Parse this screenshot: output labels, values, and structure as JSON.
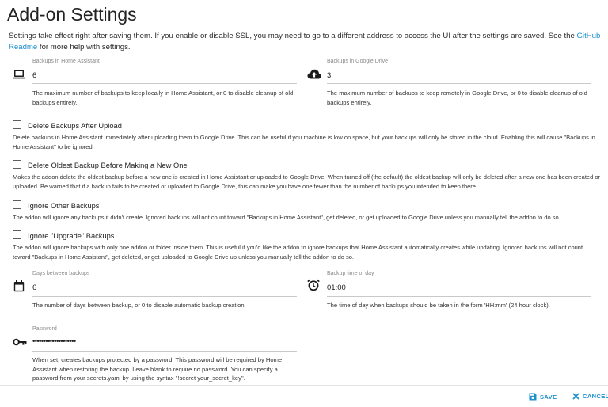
{
  "page": {
    "title": "Add-on Settings"
  },
  "intro": {
    "text_before": "Settings take effect right after saving them. If you enable or disable SSL, you may need to go to a different address to access the UI after the settings are saved. See the ",
    "link_text": "GitHub Readme",
    "text_after": " for more help with settings."
  },
  "fields": {
    "backups_ha": {
      "label": "Backups in Home Assistant",
      "value": "6",
      "help": "The maximum number of backups to keep locally in Home Assistant, or 0 to disable cleanup of old backups entirely.",
      "icon": "laptop-icon"
    },
    "backups_gd": {
      "label": "Backups in Google Drive",
      "value": "3",
      "help": "The maximum number of backups to keep remotely in Google Drive, or 0 to disable cleanup of old backups entirely.",
      "icon": "cloud-upload-icon"
    },
    "days_between": {
      "label": "Days between backups",
      "value": "6",
      "help": "The number of days between backup, or 0 to disable automatic backup creation.",
      "icon": "calendar-icon"
    },
    "backup_time": {
      "label": "Backup time of day",
      "value": "01:00",
      "help": "The time of day when backups should be taken in the form 'HH:mm' (24 hour clock).",
      "icon": "alarm-clock-icon"
    },
    "password": {
      "label": "Password",
      "value": "••••••••••••••••••••",
      "help": "When set, creates backups protected by a password. This password will be required by Home Assistant when restoring the backup. Leave blank to require no password. You can specify a password from your secrets.yaml by using the syntax \"!secret your_secret_key\".",
      "icon": "key-icon"
    }
  },
  "options": [
    {
      "label": "Delete Backups After Upload",
      "checked": false,
      "description": "Delete backups in Home Assistant immediately after uploading them to Google Drive. This can be useful if you machine is low on space, but your backups will only be stored in the cloud. Enabling this will cause \"Backups in Home Assistant\" to be ignored."
    },
    {
      "label": "Delete Oldest Backup Before Making a New One",
      "checked": false,
      "description": "Makes the addon delete the oldest backup before a new one is created in Home Assistant or uploaded to Google Drive. When turned off (the default) the oldest backup will only be deleted after a new one has been created or uploaded. Be warned that if a backup fails to be created or uploaded to Google Drive, this can make you have one fewer than the number of backups you intended to keep there."
    },
    {
      "label": "Ignore Other Backups",
      "checked": false,
      "description": "The addon will ignore any backups it didn't create. Ignored backups will not count toward \"Backups in Home Assistant\", get deleted, or get uploaded to Google Drive unless you manually tell the addon to do so."
    },
    {
      "label": "Ignore \"Upgrade\" Backups",
      "checked": false,
      "description": "The addon will ignore backups with only one addon or folder inside them. This is useful if you'd like the addon to ignore backups that Home Assistant automatically creates while updating. Ignored backups will not count toward \"Backups in Home Assistant\", get deleted, or get uploaded to Google Drive up unless you manually tell the addon to do so."
    }
  ],
  "footer": {
    "save_label": "SAVE",
    "cancel_label": "CANCEL",
    "save_icon": "floppy-disk-icon",
    "cancel_icon": "close-icon"
  },
  "colors": {
    "accent": "#1c8fce",
    "text": "#1f1f1f",
    "divider": "#c9c9c9"
  }
}
